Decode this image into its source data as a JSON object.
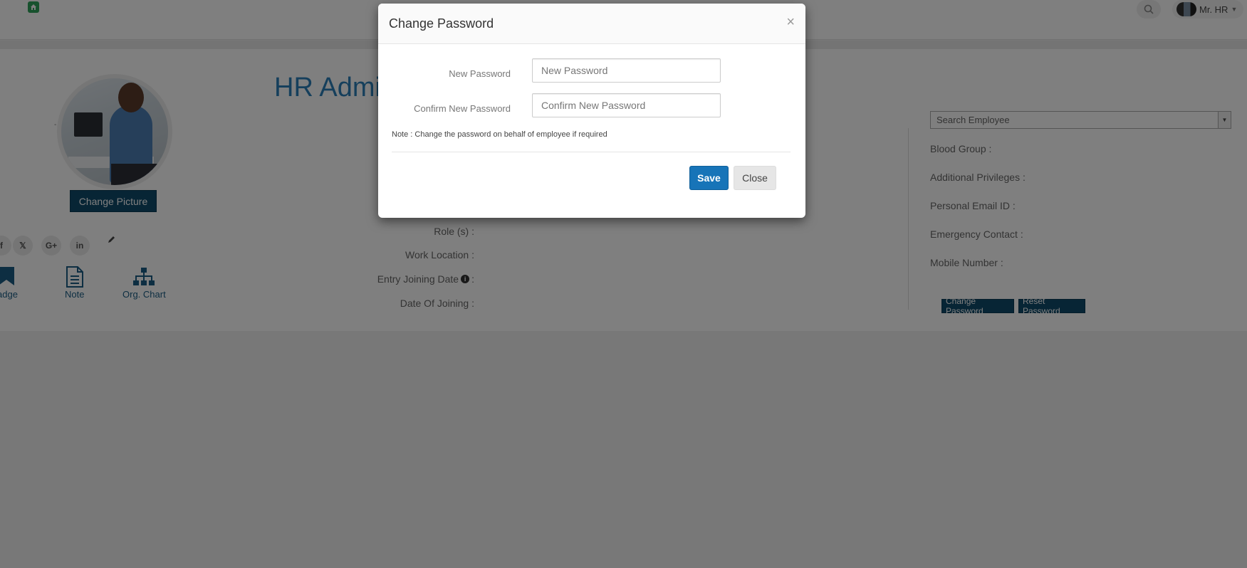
{
  "topbar": {
    "home_icon": "home-icon",
    "search_icon": "search-icon",
    "user_name": "Mr. HR"
  },
  "profile": {
    "name": "HR Admin",
    "dash_mark": "-",
    "change_picture_label": "Change Picture",
    "social": [
      "twitter-icon",
      "google-plus-icon",
      "linkedin-icon"
    ],
    "social_glyphs": [
      "𝕏",
      "G+",
      "in"
    ],
    "shortcuts": [
      {
        "label": "adge",
        "icon": "badge-icon"
      },
      {
        "label": "Note",
        "icon": "note-icon"
      },
      {
        "label": "Org. Chart",
        "icon": "org-chart-icon"
      }
    ],
    "fields": [
      {
        "label": "Role (s) :"
      },
      {
        "label": "Work Location :"
      },
      {
        "label": "Entry Joining Date",
        "info": true,
        "suffix": ":"
      },
      {
        "label": "Date Of Joining :"
      }
    ]
  },
  "right_panel": {
    "search_placeholder": "Search Employee",
    "fields": [
      "Blood Group :",
      "Additional Privileges :",
      "Personal Email ID :",
      "Emergency Contact :",
      "Mobile Number :"
    ],
    "change_password_label": "Change Password",
    "reset_password_label": "Reset Password"
  },
  "modal": {
    "title": "Change Password",
    "close_glyph": "×",
    "new_password_label": "New Password",
    "new_password_placeholder": "New Password",
    "confirm_password_label": "Confirm New Password",
    "confirm_password_placeholder": "Confirm New Password",
    "note": "Note : Change the password on behalf of employee if required",
    "save_label": "Save",
    "close_label": "Close"
  },
  "colors": {
    "primary": "#1774b8",
    "dark_button": "#0e4a6b",
    "title_blue": "#2b7fb8",
    "home_green": "#2ea35a"
  }
}
